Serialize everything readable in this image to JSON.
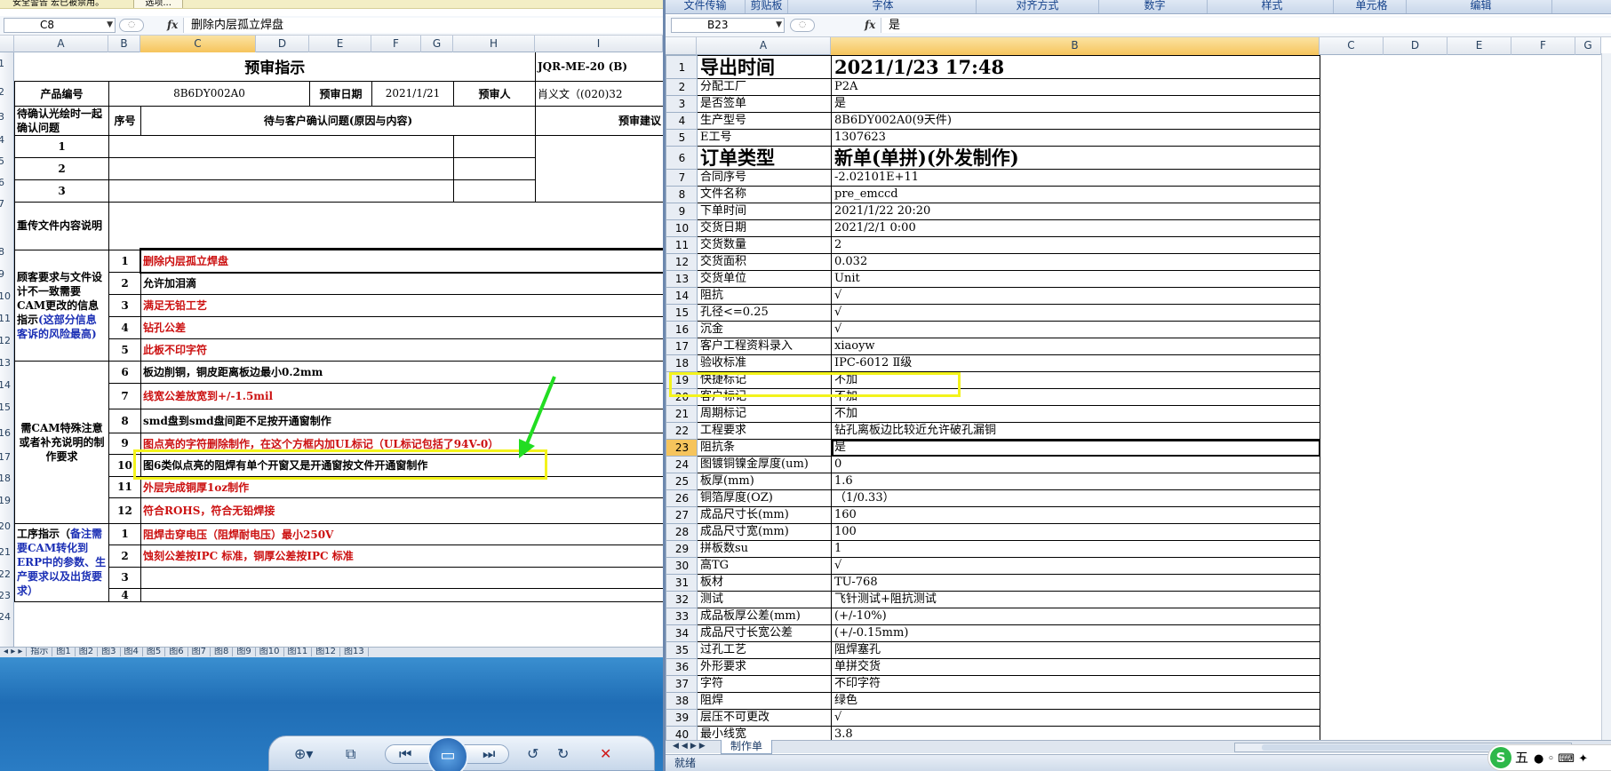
{
  "left_window": {
    "security_warning": "安全警告  宏已被禁用。",
    "security_options": "选项...",
    "name_box": "C8",
    "formula": "删除内层孤立焊盘",
    "columns": [
      "A",
      "B",
      "C",
      "D",
      "E",
      "F",
      "G",
      "H",
      "I"
    ],
    "row_numbers": [
      "1",
      "2",
      "3",
      "4",
      "5",
      "6",
      "7",
      "8",
      "9",
      "10",
      "11",
      "12",
      "13",
      "14",
      "15",
      "16",
      "17",
      "18",
      "19",
      "20",
      "21",
      "22",
      "23",
      "24"
    ],
    "title": "预审指示",
    "doc_code": "JQR-ME-20 (B)",
    "product_label": "产品编号",
    "product_value": "8B6DY002A0",
    "date_label": "预审日期",
    "date_value": "2021/1/21",
    "reviewer_label": "预审人",
    "reviewer_value": "肖义文（(020)32",
    "seq_label": "序号",
    "question_label": "待与客户确认问题(原因与内容)",
    "advice_label": "预审建议",
    "group1_label": "待确认光绘时一起确认问题",
    "group2_label": "重传文件内容说明",
    "group3_label": "顾客要求与文件设计不一致需要CAM更改的信息指示",
    "group3_note": "(这部分信息客诉的风险最高)",
    "group4_label": "需CAM特殊注意或者补充说明的制作要求",
    "group5_label": "工序指示（",
    "group5_note": "备注需要CAM转化到ERP中的参数、生产要求以及出货要求）",
    "g1_rows": [
      "1",
      "2",
      "3"
    ],
    "g3_rows": [
      {
        "n": "1",
        "text": "删除内层孤立焊盘",
        "red": true
      },
      {
        "n": "2",
        "text": "允许加泪滴",
        "red": false
      },
      {
        "n": "3",
        "text": "满足无铅工艺",
        "red": true
      },
      {
        "n": "4",
        "text": "钻孔公差",
        "red": true
      },
      {
        "n": "5",
        "text": "此板不印字符",
        "red": true
      }
    ],
    "g4_rows": [
      {
        "n": "6",
        "text": "板边削铜，铜皮距离板边最小0.2mm",
        "red": false
      },
      {
        "n": "7",
        "text": "线宽公差放宽到+/-1.5mil",
        "red": true
      },
      {
        "n": "8",
        "text": "smd盘到smd盘间距不足按开通窗制作",
        "red": false
      },
      {
        "n": "9",
        "text": "图点亮的字符删除制作，在这个方框内加UL标记（UL标记包括了94V-0）",
        "red": true
      },
      {
        "n": "10",
        "text": "图6类似点亮的阻焊有单个开窗又是开通窗按文件开通窗制作",
        "red": false
      },
      {
        "n": "11",
        "text": "外层完成铜厚1oz制作",
        "red": true
      },
      {
        "n": "12",
        "text": "符合ROHS，符合无铅焊接",
        "red": true
      }
    ],
    "g5_rows": [
      {
        "n": "1",
        "text": "阻焊击穿电压（阻焊耐电压）最小250V",
        "red": true
      },
      {
        "n": "2",
        "text": "蚀刻公差按IPC 标准，铜厚公差按IPC 标准",
        "red": true
      },
      {
        "n": "3",
        "text": "",
        "red": false
      },
      {
        "n": "4",
        "text": "",
        "red": false
      }
    ],
    "sheet_tabs": [
      "指示",
      "图1",
      "图2",
      "图3",
      "图4",
      "图5",
      "图6",
      "图7",
      "图8",
      "图9",
      "图10",
      "图11",
      "图12",
      "图13"
    ]
  },
  "right_window": {
    "ribbon_groups": [
      "文件传输",
      "剪贴板",
      "字体",
      "对齐方式",
      "数字",
      "样式",
      "单元格",
      "编辑"
    ],
    "name_box": "B23",
    "formula": "是",
    "columns": [
      "A",
      "B",
      "C",
      "D",
      "E",
      "F",
      "G"
    ],
    "rows": [
      {
        "n": "1",
        "a": "导出时间",
        "b": "2021/1/23  17:48",
        "big": true
      },
      {
        "n": "2",
        "a": "分配工厂",
        "b": "P2A"
      },
      {
        "n": "3",
        "a": "是否签单",
        "b": "是"
      },
      {
        "n": "4",
        "a": "生产型号",
        "b": "8B6DY002A0(9天件)"
      },
      {
        "n": "5",
        "a": "E工号",
        "b": "1307623"
      },
      {
        "n": "6",
        "a": "订单类型",
        "b": "新单(单拼)(外发制作)",
        "big": true
      },
      {
        "n": "7",
        "a": "合同序号",
        "b": "-2.02101E+11"
      },
      {
        "n": "8",
        "a": "文件名称",
        "b": "pre_emccd"
      },
      {
        "n": "9",
        "a": "下单时间",
        "b": "2021/1/22 20:20"
      },
      {
        "n": "10",
        "a": "交货日期",
        "b": "2021/2/1 0:00"
      },
      {
        "n": "11",
        "a": "交货数量",
        "b": "2"
      },
      {
        "n": "12",
        "a": "交货面积",
        "b": "0.032"
      },
      {
        "n": "13",
        "a": "交货单位",
        "b": "Unit"
      },
      {
        "n": "14",
        "a": "阻抗",
        "b": "√"
      },
      {
        "n": "15",
        "a": "孔径<=0.25",
        "b": "√"
      },
      {
        "n": "16",
        "a": "沉金",
        "b": "√"
      },
      {
        "n": "17",
        "a": "客户工程资料录入",
        "b": "xiaoyw"
      },
      {
        "n": "18",
        "a": "验收标准",
        "b": "IPC-6012 Ⅱ级"
      },
      {
        "n": "19",
        "a": "快捷标记",
        "b": "不加"
      },
      {
        "n": "20",
        "a": "客户标记",
        "b": "不加"
      },
      {
        "n": "21",
        "a": "周期标记",
        "b": "不加"
      },
      {
        "n": "22",
        "a": "工程要求",
        "b": "钻孔离板边比较近允许破孔漏铜"
      },
      {
        "n": "23",
        "a": "阻抗条",
        "b": "是"
      },
      {
        "n": "24",
        "a": "图镀铜镍金厚度(um)",
        "b": "0"
      },
      {
        "n": "25",
        "a": "板厚(mm)",
        "b": "1.6"
      },
      {
        "n": "26",
        "a": "铜箔厚度(OZ)",
        "b": "（1/0.33）"
      },
      {
        "n": "27",
        "a": "成品尺寸长(mm)",
        "b": "160"
      },
      {
        "n": "28",
        "a": "成品尺寸宽(mm)",
        "b": "100"
      },
      {
        "n": "29",
        "a": "拼板数su",
        "b": "1"
      },
      {
        "n": "30",
        "a": "高TG",
        "b": "√"
      },
      {
        "n": "31",
        "a": "板材",
        "b": "TU-768"
      },
      {
        "n": "32",
        "a": "测试",
        "b": "飞针测试+阻抗测试"
      },
      {
        "n": "33",
        "a": "成品板厚公差(mm)",
        "b": "(+/-10%)"
      },
      {
        "n": "34",
        "a": "成品尺寸长宽公差",
        "b": "(+/-0.15mm)"
      },
      {
        "n": "35",
        "a": "过孔工艺",
        "b": "阻焊塞孔"
      },
      {
        "n": "36",
        "a": "外形要求",
        "b": "单拼交货"
      },
      {
        "n": "37",
        "a": "字符",
        "b": "不印字符"
      },
      {
        "n": "38",
        "a": "阻焊",
        "b": "绿色"
      },
      {
        "n": "39",
        "a": "层压不可更改",
        "b": "√"
      },
      {
        "n": "40",
        "a": "最小线宽",
        "b": "3.8"
      }
    ],
    "sheet_tab": "制作单",
    "status": "就绪",
    "ime_label": "五"
  },
  "colors": {
    "highlight_box": "#f3f31b",
    "arrow": "#22dd22",
    "red_text": "#cc1111",
    "blue_text": "#1b2fb5",
    "selected_header": "#f6c45c"
  }
}
